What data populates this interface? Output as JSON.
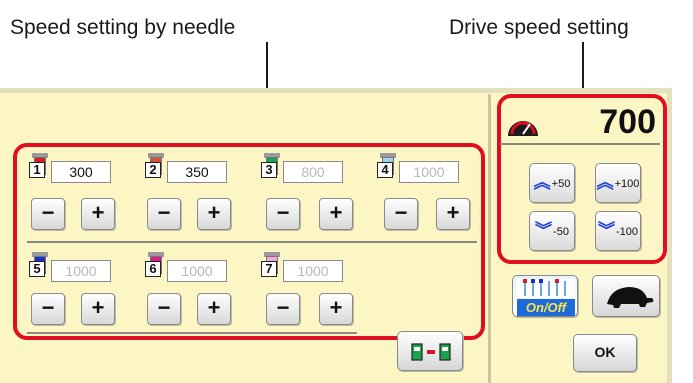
{
  "captions": {
    "needle_speed": "Speed setting by needle",
    "drive_speed": "Drive speed setting"
  },
  "needles": [
    {
      "number": "1",
      "value": "300",
      "color": "#d81e24",
      "active": true
    },
    {
      "number": "2",
      "value": "350",
      "color": "#d9523c",
      "active": true
    },
    {
      "number": "3",
      "value": "800",
      "color": "#1ba34b",
      "active": false
    },
    {
      "number": "4",
      "value": "1000",
      "color": "#9fd2f2",
      "active": false
    },
    {
      "number": "5",
      "value": "1000",
      "color": "#1931c8",
      "active": false
    },
    {
      "number": "6",
      "value": "1000",
      "color": "#e31a8c",
      "active": false
    },
    {
      "number": "7",
      "value": "1000",
      "color": "#f5a6da",
      "active": false
    }
  ],
  "stepper": {
    "minus": "−",
    "plus": "+"
  },
  "drive": {
    "speed": "700",
    "buttons": {
      "up50": "+50",
      "up100": "+100",
      "down50": "-50",
      "down100": "-100"
    },
    "ok_label": "OK",
    "onoff_label": "On/Off"
  },
  "colors": {
    "highlight": "#e10d22",
    "panel": "#fbf6c4",
    "arrow": "#1c3fd0"
  }
}
